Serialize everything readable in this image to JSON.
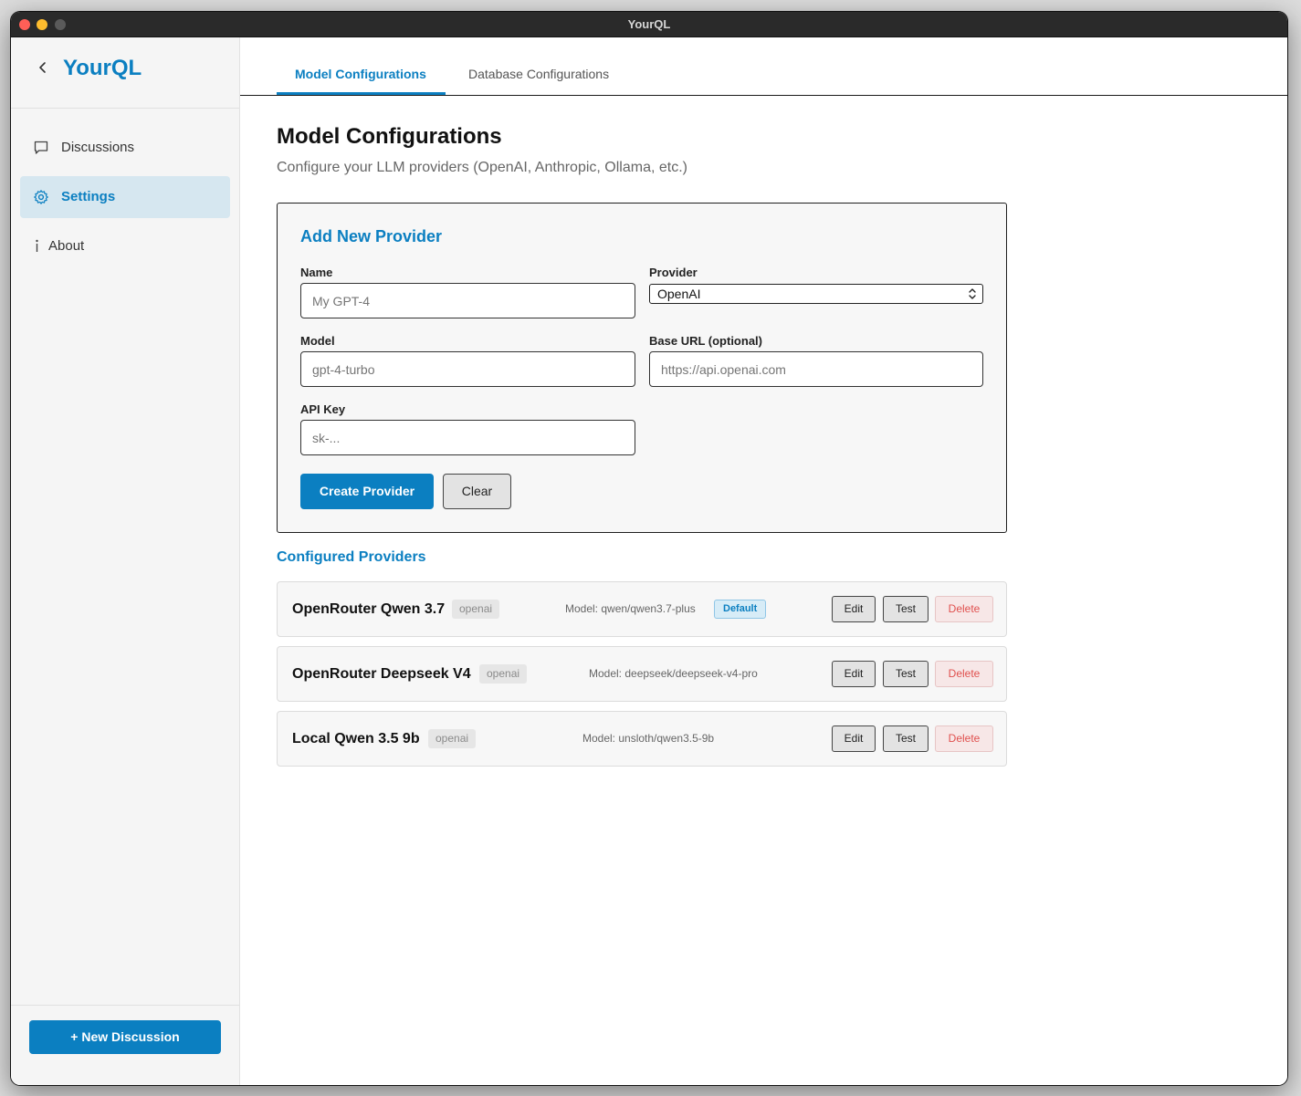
{
  "window": {
    "title": "YourQL"
  },
  "sidebar": {
    "brand": "YourQL",
    "items": [
      {
        "label": "Discussions",
        "icon": "chat-bubble-icon",
        "active": false
      },
      {
        "label": "Settings",
        "icon": "gear-icon",
        "active": true
      },
      {
        "label": "About",
        "icon": "info-icon",
        "active": false
      }
    ],
    "new_discussion_label": "New Discussion",
    "new_discussion_prefix": "+"
  },
  "tabs": [
    {
      "label": "Model Configurations",
      "active": true
    },
    {
      "label": "Database Configurations",
      "active": false
    }
  ],
  "page": {
    "title": "Model Configurations",
    "subtitle": "Configure your LLM providers (OpenAI, Anthropic, Ollama, etc.)"
  },
  "form": {
    "title": "Add New Provider",
    "name": {
      "label": "Name",
      "placeholder": "My GPT-4",
      "value": ""
    },
    "provider": {
      "label": "Provider",
      "value": "OpenAI"
    },
    "model": {
      "label": "Model",
      "placeholder": "gpt-4-turbo",
      "value": ""
    },
    "base_url": {
      "label": "Base URL (optional)",
      "placeholder": "https://api.openai.com",
      "value": ""
    },
    "api_key": {
      "label": "API Key",
      "placeholder": "sk-...",
      "value": ""
    },
    "create_label": "Create Provider",
    "clear_label": "Clear"
  },
  "configured": {
    "title": "Configured Providers",
    "providers": [
      {
        "name": "OpenRouter Qwen 3.7",
        "type": "openai",
        "model": "Model: qwen/qwen3.7-plus",
        "default_label": "Default"
      },
      {
        "name": "OpenRouter Deepseek V4",
        "type": "openai",
        "model": "Model: deepseek/deepseek-v4-pro",
        "default_label": ""
      },
      {
        "name": "Local Qwen 3.5 9b",
        "type": "openai",
        "model": "Model: unsloth/qwen3.5-9b",
        "default_label": ""
      }
    ],
    "edit_label": "Edit",
    "test_label": "Test",
    "delete_label": "Delete"
  },
  "colors": {
    "accent": "#0b7fc1",
    "danger": "#e0504e",
    "sidebar_active_bg": "#d6e7f0"
  }
}
